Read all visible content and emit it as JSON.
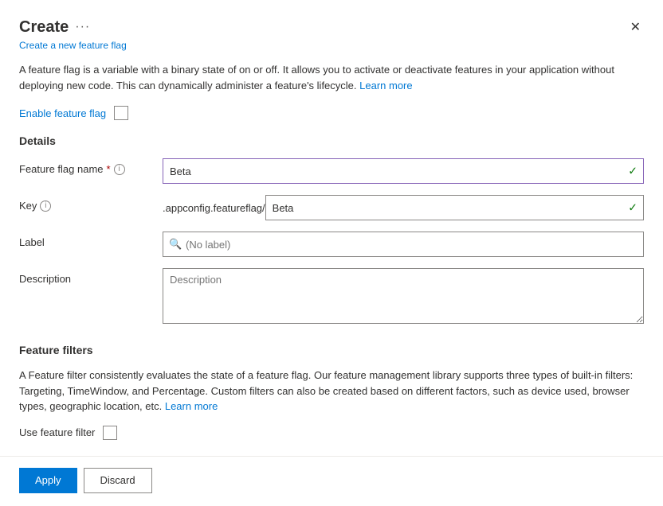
{
  "dialog": {
    "title": "Create",
    "ellipsis": "···",
    "subtitle": "Create a new feature flag",
    "close_label": "×"
  },
  "intro": {
    "text_before_activate": "A feature flag is a variable with a binary state of on or off. It allows you to activate or deactivate features in your application without deploying new code. This can dynamically administer a feature's lifecycle.",
    "learn_more": "Learn more",
    "text1": "A feature flag is a variable with a binary state of on or off. It allows you to activate or deactivate features in your application",
    "text2": "without deploying new code. This can dynamically administer a feature's lifecycle.",
    "link_text": "Learn more"
  },
  "enable": {
    "label": "Enable feature flag"
  },
  "details": {
    "section_title": "Details",
    "feature_flag_name_label": "Feature flag name",
    "feature_flag_name_required": "*",
    "feature_flag_name_value": "Beta",
    "key_label": "Key",
    "key_prefix": ".appconfig.featureflag/",
    "key_value": "Beta",
    "label_label": "Label",
    "label_placeholder": "(No label)",
    "description_label": "Description",
    "description_placeholder": "Description"
  },
  "feature_filters": {
    "section_title": "Feature filters",
    "intro_text1": "A Feature filter consistently evaluates the state of a feature flag. Our feature management library supports three types of built-in filters: Targeting, TimeWindow, and Percentage. Custom filters can also be created based on different factors, such as device used, browser types, geographic location, etc.",
    "learn_more": "Learn more",
    "use_filter_label": "Use feature filter"
  },
  "footer": {
    "apply_label": "Apply",
    "discard_label": "Discard"
  },
  "icons": {
    "close": "✕",
    "check": "✓",
    "info": "i",
    "search": "🔍"
  }
}
